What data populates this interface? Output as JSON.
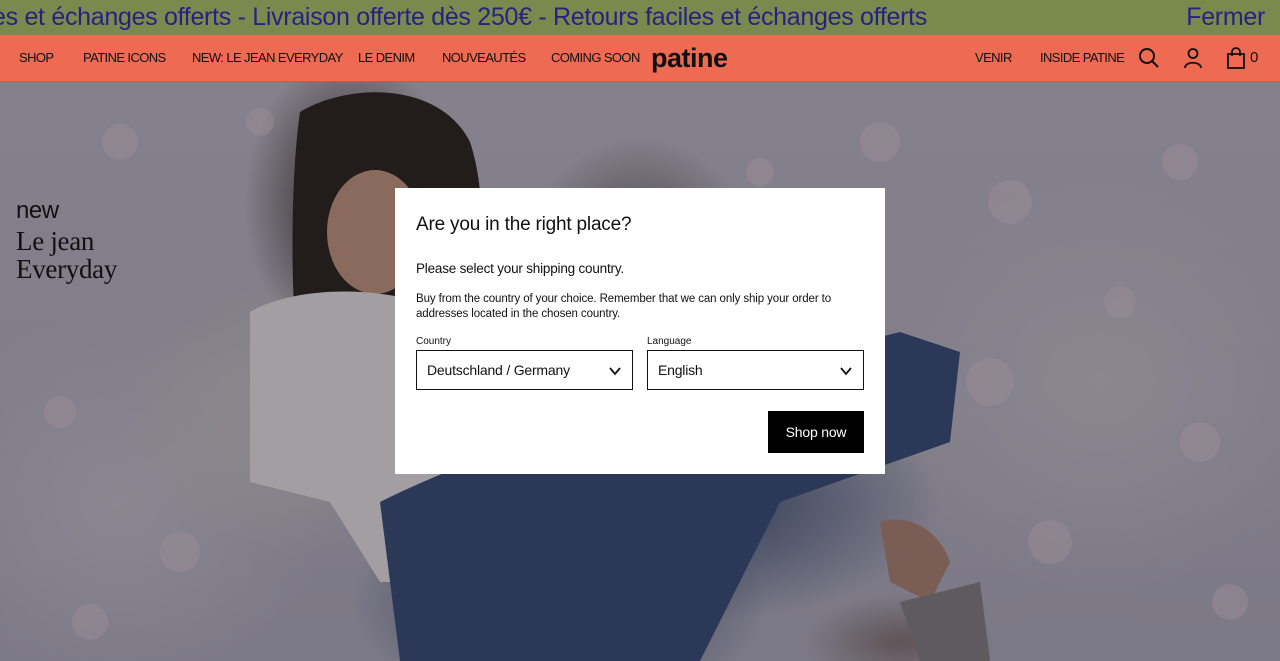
{
  "announcement": {
    "text": "es et échanges offerts - Livraison offerte dès 250€ - Retours faciles et échanges offerts",
    "close_label": "Fermer"
  },
  "header": {
    "nav_left": [
      {
        "label": "SHOP"
      },
      {
        "label": "PATINE ICONS"
      },
      {
        "label": "NEW: LE JEAN EVERYDAY"
      },
      {
        "label": "LE DENIM"
      },
      {
        "label": "NOUVEAUTÉS"
      },
      {
        "label": "COMING SOON"
      }
    ],
    "logo": "patine",
    "nav_right": [
      {
        "label": "VENIR"
      },
      {
        "label": "INSIDE PATINE"
      }
    ],
    "icons": {
      "search": "search-icon",
      "account": "user-icon",
      "cart": "bag-icon"
    },
    "cart_count": "0"
  },
  "hero": {
    "tag_line1": "new",
    "tag_line2": "Le jean",
    "tag_line3": "Everyday"
  },
  "modal": {
    "title": "Are you in the right place?",
    "subtitle": "Please select your shipping country.",
    "info": "Buy from the country of your choice. Remember that we can only ship your order to addresses located in the chosen country.",
    "country_label": "Country",
    "country_value": "Deutschland / Germany",
    "language_label": "Language",
    "language_value": "English",
    "button_label": "Shop now"
  },
  "colors": {
    "announcement_bg": "#7a8a4e",
    "announcement_text": "#25237f",
    "header_bg": "#ee6a53",
    "button_bg": "#000000"
  }
}
